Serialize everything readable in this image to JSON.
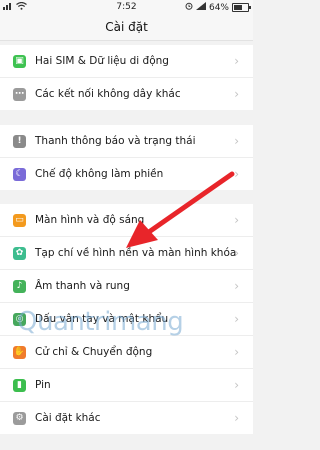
{
  "status_bar": {
    "time": "7:52",
    "battery_text": "64%",
    "battery_level": 0.64,
    "left_icons": [
      "signal-icon",
      "wifi-icon"
    ],
    "right_icons": [
      "alarm-icon",
      "signal-icon"
    ]
  },
  "header": {
    "title": "Cài đặt"
  },
  "groups": [
    {
      "items": [
        {
          "label": "Hai SIM & Dữ liệu di động",
          "icon": "sim-card-icon",
          "color": "#3ec251"
        },
        {
          "label": "Các kết nối không dây khác",
          "icon": "more-icon",
          "color": "#9b9b9b"
        }
      ]
    },
    {
      "items": [
        {
          "label": "Thanh thông báo và trạng thái",
          "icon": "notification-icon",
          "color": "#8a8a8a"
        },
        {
          "label": "Chế độ không làm phiền",
          "icon": "moon-icon",
          "color": "#7a6bd8"
        }
      ]
    },
    {
      "items": [
        {
          "label": "Màn hình và độ sáng",
          "icon": "display-icon",
          "color": "#f39a1e"
        },
        {
          "label": "Tạp chí về hình nền và màn hình khóa",
          "icon": "wallpaper-icon",
          "color": "#3dbd8f"
        },
        {
          "label": "Âm thanh và rung",
          "icon": "sound-icon",
          "color": "#44b25a"
        },
        {
          "label": "Dấu vân tay và mật khẩu",
          "icon": "fingerprint-icon",
          "color": "#46a85c"
        },
        {
          "label": "Cử chỉ & Chuyển động",
          "icon": "gesture-icon",
          "color": "#f07b2c"
        },
        {
          "label": "Pin",
          "icon": "battery-icon",
          "color": "#3cbe4e"
        },
        {
          "label": "Cài đặt khác",
          "icon": "other-settings-icon",
          "color": "#9b9b9b"
        }
      ]
    }
  ],
  "watermark": {
    "text": "Quantrimang"
  },
  "colors": {
    "arrow": "#e8252a"
  }
}
